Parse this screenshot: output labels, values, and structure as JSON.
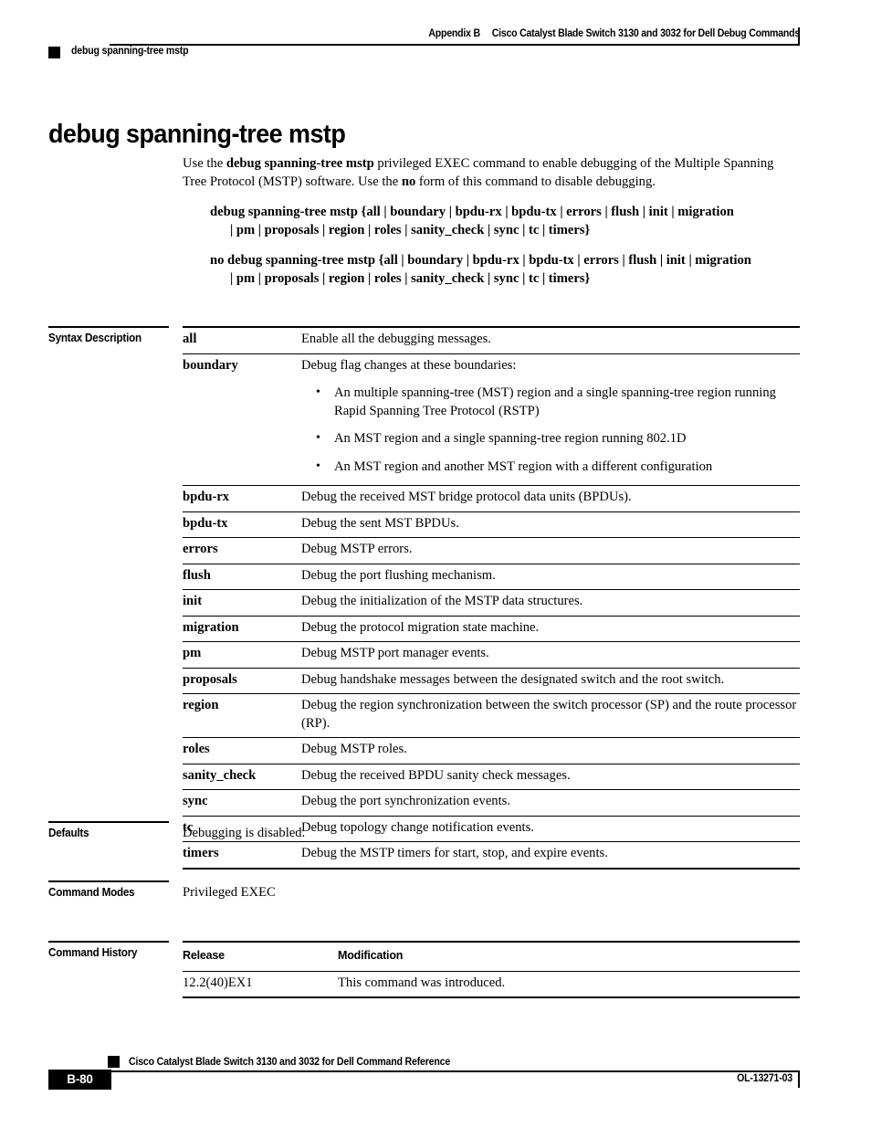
{
  "header": {
    "appendix": "Appendix B",
    "book_title": "Cisco Catalyst Blade Switch 3130 and 3032 for Dell Debug Commands",
    "running_head": "debug spanning-tree mstp"
  },
  "title": "debug spanning-tree mstp",
  "intro": {
    "before_bold": "Use the ",
    "bold_command": "debug spanning-tree mstp",
    "after_bold": " privileged EXEC command to enable debugging of the Multiple Spanning Tree Protocol (MSTP) software. Use the ",
    "bold_no": "no",
    "tail": " form of this command to disable debugging."
  },
  "syntax": {
    "line1_part1": "debug spanning-tree mstp {all | boundary | bpdu-rx | bpdu-tx | errors | flush | init | migration",
    "line1_part2": "| pm | proposals | region | roles | sanity_check | sync | tc | timers}",
    "line2_part1": "no debug spanning-tree mstp {all | boundary | bpdu-rx | bpdu-tx | errors | flush | init | migration",
    "line2_part2": "| pm | proposals | region | roles | sanity_check | sync | tc | timers}"
  },
  "sections": {
    "syntax_description": "Syntax Description",
    "defaults": "Defaults",
    "command_modes": "Command Modes",
    "command_history": "Command History"
  },
  "syntax_description_rows": [
    {
      "keyword": "all",
      "description": "Enable all the debugging messages."
    },
    {
      "keyword": "boundary",
      "description": "Debug flag changes at these boundaries:",
      "bullets": [
        "An multiple spanning-tree (MST) region and a single spanning-tree region running Rapid Spanning Tree Protocol (RSTP)",
        "An MST region and a single spanning-tree region running 802.1D",
        "An MST region and another MST region with a different configuration"
      ]
    },
    {
      "keyword": "bpdu-rx",
      "description": "Debug the received MST bridge protocol data units (BPDUs)."
    },
    {
      "keyword": "bpdu-tx",
      "description": "Debug the sent MST BPDUs."
    },
    {
      "keyword": "errors",
      "description": "Debug MSTP errors."
    },
    {
      "keyword": "flush",
      "description": "Debug the port flushing mechanism."
    },
    {
      "keyword": "init",
      "description": "Debug the initialization of the MSTP data structures."
    },
    {
      "keyword": "migration",
      "description": "Debug the protocol migration state machine."
    },
    {
      "keyword": "pm",
      "description": "Debug MSTP port manager events."
    },
    {
      "keyword": "proposals",
      "description": "Debug handshake messages between the designated switch and the root switch."
    },
    {
      "keyword": "region",
      "description": "Debug the region synchronization between the switch processor (SP) and the route processor (RP)."
    },
    {
      "keyword": "roles",
      "description": "Debug MSTP roles."
    },
    {
      "keyword": "sanity_check",
      "description": "Debug the received BPDU sanity check messages."
    },
    {
      "keyword": "sync",
      "description": "Debug the port synchronization events."
    },
    {
      "keyword": "tc",
      "description": "Debug topology change notification events."
    },
    {
      "keyword": "timers",
      "description": "Debug the MSTP timers for start, stop, and expire events."
    }
  ],
  "defaults_value": "Debugging is disabled.",
  "command_modes_value": "Privileged EXEC",
  "command_history": {
    "col_release": "Release",
    "col_modification": "Modification",
    "rows": [
      {
        "release": "12.2(40)EX1",
        "modification": "This command was introduced."
      }
    ]
  },
  "footer": {
    "book_title": "Cisco Catalyst Blade Switch 3130 and 3032 for Dell Command Reference",
    "page_number": "B-80",
    "doc_number": "OL-13271-03"
  }
}
